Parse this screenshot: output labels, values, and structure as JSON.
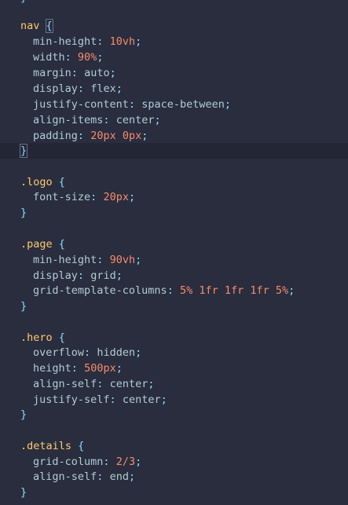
{
  "code": {
    "nav_block": {
      "selector": "nav",
      "props": [
        {
          "name": "min-height",
          "num": "10",
          "unit": "vh",
          "text": ""
        },
        {
          "name": "width",
          "num": "90",
          "unit": "%",
          "text": ""
        },
        {
          "name": "margin",
          "num": "",
          "unit": "",
          "text": "auto"
        },
        {
          "name": "display",
          "num": "",
          "unit": "",
          "text": "flex"
        },
        {
          "name": "justify-content",
          "num": "",
          "unit": "",
          "text": "space-between"
        },
        {
          "name": "align-items",
          "num": "",
          "unit": "",
          "text": "center"
        },
        {
          "name": "padding",
          "num": "20",
          "unit": "px",
          "text": "",
          "num2": "0",
          "unit2": "px"
        }
      ]
    },
    "logo_block": {
      "selector": ".logo",
      "props": [
        {
          "name": "font-size",
          "num": "20",
          "unit": "px"
        }
      ]
    },
    "page_block": {
      "selector": ".page",
      "props": [
        {
          "name": "min-height",
          "num": "90",
          "unit": "vh"
        },
        {
          "name": "display",
          "text": "grid"
        },
        {
          "name": "grid-template-columns",
          "text": "5% 1fr 1fr 1fr 5%"
        }
      ]
    },
    "hero_block": {
      "selector": ".hero",
      "props": [
        {
          "name": "overflow",
          "text": "hidden"
        },
        {
          "name": "height",
          "num": "500",
          "unit": "px"
        },
        {
          "name": "align-self",
          "text": "center"
        },
        {
          "name": "justify-self",
          "text": "center"
        }
      ]
    },
    "details_block": {
      "selector": ".details",
      "props": [
        {
          "name": "grid-column",
          "text": "2/3"
        },
        {
          "name": "align-self",
          "text": "end"
        }
      ]
    },
    "open_brace": "{",
    "close_brace": "}",
    "colon": ":",
    "semicolon": ";"
  }
}
